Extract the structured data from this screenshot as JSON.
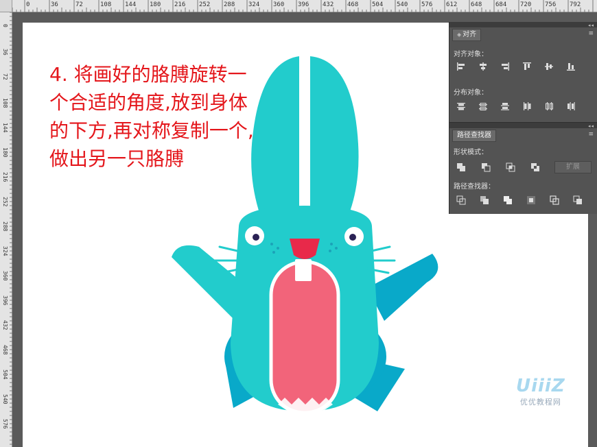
{
  "ruler": {
    "top_ticks": [
      "0",
      "36",
      "72",
      "108",
      "144",
      "180",
      "216",
      "252",
      "288",
      "324",
      "360",
      "396",
      "432",
      "468",
      "504",
      "540",
      "576",
      "612",
      "648",
      "684",
      "720",
      "756",
      "792"
    ],
    "left_ticks": [
      "0",
      "36",
      "72",
      "108",
      "144",
      "180",
      "216",
      "252",
      "288",
      "324",
      "360",
      "396",
      "432",
      "468",
      "504",
      "540",
      "576"
    ]
  },
  "canvas": {
    "instruction_lines": [
      "4. 将画好的胳膊旋转一",
      "个合适的角度,放到身体",
      "的下方,再对称复制一个,",
      "做出另一只胳膊"
    ]
  },
  "align_panel": {
    "tab_label": "对齐",
    "align_objects_label": "对齐对象：",
    "distribute_objects_label": "分布对象：",
    "align_icons": [
      "align-left-icon",
      "align-horizontal-center-icon",
      "align-right-icon",
      "align-top-icon",
      "align-vertical-center-icon",
      "align-bottom-icon"
    ],
    "distribute_icons": [
      "distribute-top-icon",
      "distribute-vertical-center-icon",
      "distribute-bottom-icon",
      "distribute-left-icon",
      "distribute-horizontal-center-icon",
      "distribute-right-icon"
    ]
  },
  "pathfinder_panel": {
    "tab_label": "路径查找器",
    "shape_modes_label": "形状模式：",
    "expand_label": "扩展",
    "pathfinders_label": "路径查找器：",
    "shape_mode_icons": [
      "unite-icon",
      "minus-front-icon",
      "intersect-icon",
      "exclude-icon"
    ],
    "pathfinder_icons": [
      "divide-icon",
      "trim-icon",
      "merge-icon",
      "crop-icon",
      "outline-icon",
      "minus-back-icon"
    ]
  },
  "watermark": {
    "logo": "UiiiZ",
    "text": "优优教程网"
  },
  "colors": {
    "rabbit_body": "#22cccc",
    "rabbit_dark": "#09a9c9",
    "mouth": "#f2647a",
    "nose": "#e8294a",
    "instruction_text": "#e4161b"
  }
}
